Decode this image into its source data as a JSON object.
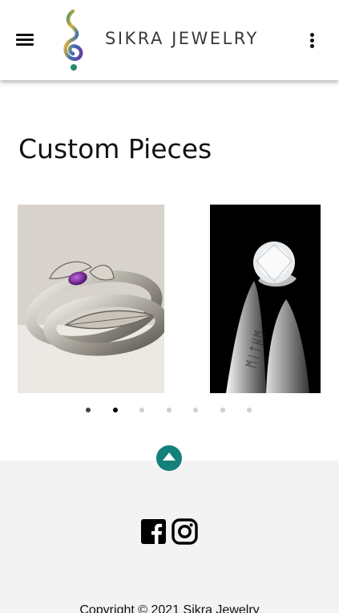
{
  "header": {
    "brand": "SIKRA JEWELRY",
    "menu_icon": "hamburger-menu-icon",
    "more_icon": "vertical-dots-icon",
    "logo_colors": [
      "#2a8b6f",
      "#d9b23a",
      "#3a6fb5",
      "#6a3aa0"
    ]
  },
  "main": {
    "section_title": "Custom Pieces",
    "carousel": {
      "slides": [
        {
          "subject": "silver leaf ring with amethyst"
        },
        {
          "subject": "engraved silver ring with diamond"
        }
      ],
      "dot_count": 7,
      "active_index": 1
    }
  },
  "back_to_top": {
    "icon": "arrow-up-icon",
    "color": "#13807a"
  },
  "footer": {
    "social": [
      {
        "name": "Facebook",
        "icon": "facebook-icon"
      },
      {
        "name": "Instagram",
        "icon": "instagram-icon"
      }
    ],
    "copyright": "Copyright © 2021 Sikra Jewelry"
  }
}
